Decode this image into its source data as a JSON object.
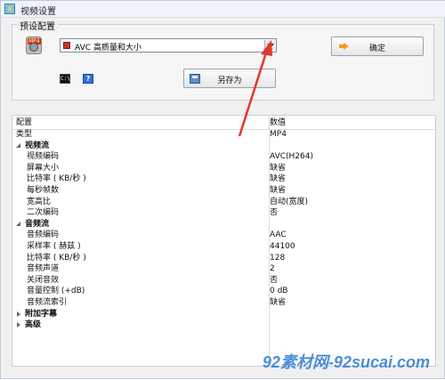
{
  "window": {
    "title": "视频设置"
  },
  "preset": {
    "group_title": "预设配置",
    "selected_preset": "AVC 高质量和大小",
    "ok_label": "确定",
    "saveas_label": "另存为"
  },
  "icons": {
    "mp4_tag": "MP4",
    "cmd_text": "C:\\",
    "help_text": "?"
  },
  "table": {
    "header": {
      "name": "配置",
      "value": "数值"
    },
    "rows": [
      {
        "name": "类型",
        "value": "MP4",
        "level": 0
      },
      {
        "name": "视频流",
        "value": "",
        "level": 0,
        "section": true,
        "open": true
      },
      {
        "name": "视频编码",
        "value": "AVC(H264)",
        "level": 1
      },
      {
        "name": "屏幕大小",
        "value": "缺省",
        "level": 1
      },
      {
        "name": "比特率 ( KB/秒 )",
        "value": "缺省",
        "level": 1
      },
      {
        "name": "每秒帧数",
        "value": "缺省",
        "level": 1
      },
      {
        "name": "宽高比",
        "value": "自动(宽度)",
        "level": 1
      },
      {
        "name": "二次编码",
        "value": "否",
        "level": 1
      },
      {
        "name": "音频流",
        "value": "",
        "level": 0,
        "section": true,
        "open": true
      },
      {
        "name": "音频编码",
        "value": "AAC",
        "level": 1
      },
      {
        "name": "采样率 ( 赫兹 )",
        "value": "44100",
        "level": 1
      },
      {
        "name": "比特率 ( KB/秒 )",
        "value": "128",
        "level": 1
      },
      {
        "name": "音频声道",
        "value": "2",
        "level": 1
      },
      {
        "name": "关闭音效",
        "value": "否",
        "level": 1
      },
      {
        "name": "音量控制 (+dB)",
        "value": "0 dB",
        "level": 1
      },
      {
        "name": "音频流索引",
        "value": "缺省",
        "level": 1
      },
      {
        "name": "附加字幕",
        "value": "",
        "level": 0,
        "section": true,
        "open": false
      },
      {
        "name": "高级",
        "value": "",
        "level": 0,
        "section": true,
        "open": false
      }
    ]
  },
  "watermark": {
    "text": "92素材网-92sucai.com"
  },
  "colors": {
    "annotation_arrow": "#e2372a",
    "watermark": "#2f7bd0"
  }
}
